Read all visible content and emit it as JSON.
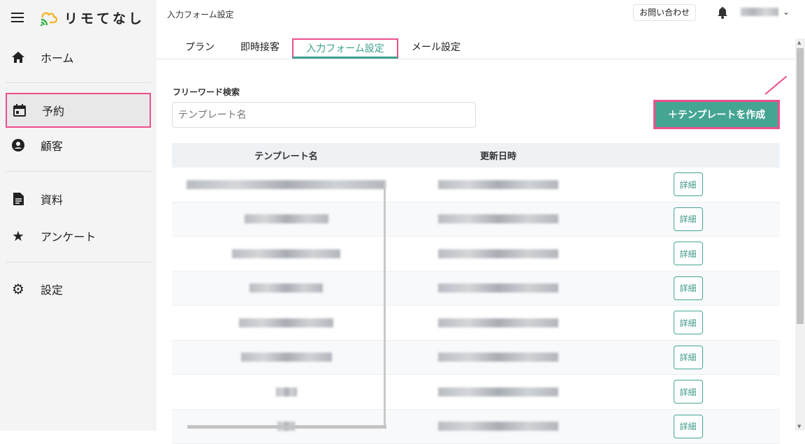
{
  "app": {
    "name": "リモてなし"
  },
  "sidebar": {
    "items": [
      {
        "label": "ホーム",
        "icon": "home-icon"
      },
      {
        "label": "予約",
        "icon": "calendar-icon",
        "active": true
      },
      {
        "label": "顧客",
        "icon": "account-circle-icon"
      },
      {
        "label": "資料",
        "icon": "document-icon"
      },
      {
        "label": "アンケート",
        "icon": "star-icon"
      },
      {
        "label": "設定",
        "icon": "gear-icon"
      }
    ]
  },
  "header": {
    "title": "入力フォーム設定",
    "contact": "お問い合わせ"
  },
  "tabs": [
    {
      "label": "プラン"
    },
    {
      "label": "即時接客"
    },
    {
      "label": "入力フォーム設定",
      "active": true
    },
    {
      "label": "メール設定"
    }
  ],
  "search": {
    "label": "フリーワード検索",
    "placeholder": "テンプレート名"
  },
  "create_button": "＋テンプレートを作成",
  "table": {
    "headers": [
      "テンプレート名",
      "更新日時",
      ""
    ],
    "detail_label": "詳細",
    "row_count": 8
  },
  "colors": {
    "accent": "#45a593",
    "highlight": "#ec4f8c"
  }
}
